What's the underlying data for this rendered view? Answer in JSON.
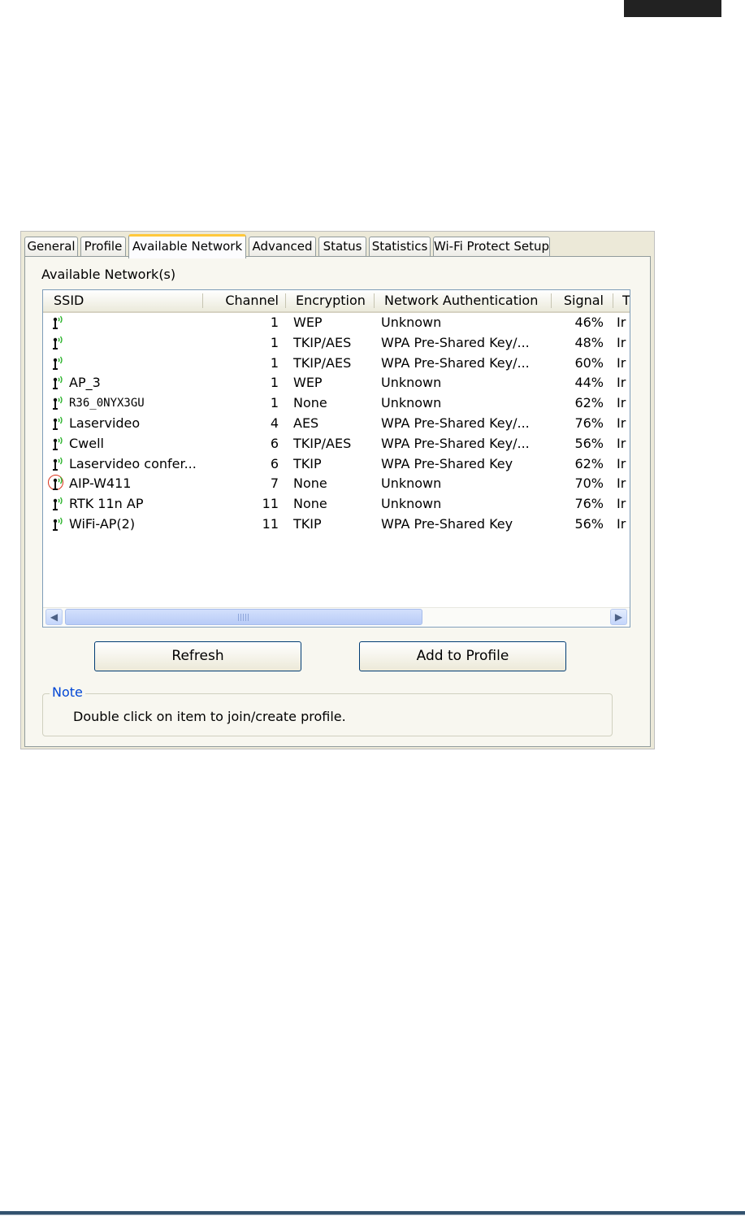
{
  "tabs": [
    {
      "label": "General",
      "active": false
    },
    {
      "label": "Profile",
      "active": false
    },
    {
      "label": "Available Network",
      "active": true
    },
    {
      "label": "Advanced",
      "active": false
    },
    {
      "label": "Status",
      "active": false
    },
    {
      "label": "Statistics",
      "active": false
    },
    {
      "label": "Wi-Fi Protect Setup",
      "active": false
    }
  ],
  "section_title": "Available Network(s)",
  "columns": [
    "SSID",
    "Channel",
    "Encryption",
    "Network Authentication",
    "Signal",
    "T"
  ],
  "networks": [
    {
      "ssid": "",
      "channel": "1",
      "encryption": "WEP",
      "auth": "Unknown",
      "signal": "46%",
      "type": "Ir"
    },
    {
      "ssid": "",
      "channel": "1",
      "encryption": "TKIP/AES",
      "auth": "WPA Pre-Shared Key/...",
      "signal": "48%",
      "type": "Ir"
    },
    {
      "ssid": "",
      "channel": "1",
      "encryption": "TKIP/AES",
      "auth": "WPA Pre-Shared Key/...",
      "signal": "60%",
      "type": "Ir"
    },
    {
      "ssid": "AP_3",
      "channel": "1",
      "encryption": "WEP",
      "auth": "Unknown",
      "signal": "44%",
      "type": "Ir"
    },
    {
      "ssid": "R36_0NYX3GU",
      "channel": "1",
      "encryption": "None",
      "auth": "Unknown",
      "signal": "62%",
      "type": "Ir"
    },
    {
      "ssid": "Laservideo",
      "channel": "4",
      "encryption": "AES",
      "auth": "WPA Pre-Shared Key/...",
      "signal": "76%",
      "type": "Ir"
    },
    {
      "ssid": "Cwell",
      "channel": "6",
      "encryption": "TKIP/AES",
      "auth": "WPA Pre-Shared Key/...",
      "signal": "56%",
      "type": "Ir"
    },
    {
      "ssid": "Laservideo confer...",
      "channel": "6",
      "encryption": "TKIP",
      "auth": "WPA Pre-Shared Key",
      "signal": "62%",
      "type": "Ir"
    },
    {
      "ssid": "AIP-W411",
      "channel": "7",
      "encryption": "None",
      "auth": "Unknown",
      "signal": "70%",
      "type": "Ir"
    },
    {
      "ssid": "RTK 11n AP",
      "channel": "11",
      "encryption": "None",
      "auth": "Unknown",
      "signal": "76%",
      "type": "Ir"
    },
    {
      "ssid": "WiFi-AP(2)",
      "channel": "11",
      "encryption": "TKIP",
      "auth": "WPA Pre-Shared Key",
      "signal": "56%",
      "type": "Ir"
    }
  ],
  "highlighted_ssid": "AIP-W411",
  "buttons": {
    "refresh": "Refresh",
    "add_to_profile": "Add to Profile"
  },
  "note": {
    "legend": "Note",
    "text": "Double click on item to join/create profile."
  },
  "icons": {
    "network": "wireless-signal-icon",
    "scroll_left": "arrow-left-icon",
    "scroll_right": "arrow-right-icon"
  },
  "colors": {
    "tab_highlight": "#ffc83c",
    "note_legend": "#0046d5",
    "signal_green": "#2fb52f",
    "marker_circle": "#d9331a"
  }
}
